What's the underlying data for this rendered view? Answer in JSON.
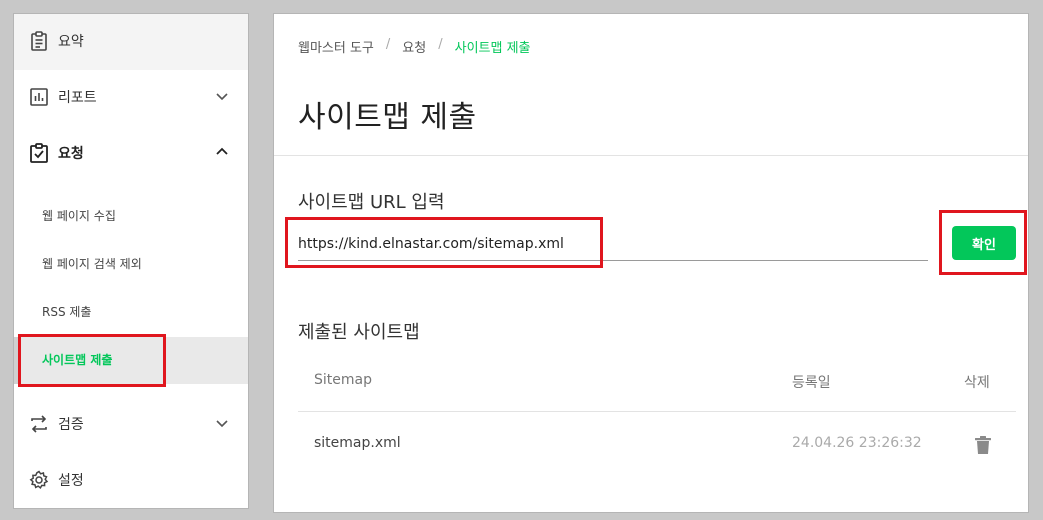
{
  "sidebar": {
    "items": [
      {
        "label": "요약",
        "icon": "clipboard-icon"
      },
      {
        "label": "리포트",
        "icon": "bar-chart-icon"
      },
      {
        "label": "요청",
        "icon": "clipboard-check-icon"
      },
      {
        "label": "검증",
        "icon": "swap-arrows-icon"
      },
      {
        "label": "설정",
        "icon": "gear-icon"
      }
    ],
    "sub_items": [
      {
        "label": "웹 페이지 수집"
      },
      {
        "label": "웹 페이지 검색 제외"
      },
      {
        "label": "RSS 제출"
      },
      {
        "label": "사이트맵 제출"
      }
    ]
  },
  "breadcrumb": {
    "items": [
      "웹마스터 도구",
      "요청",
      "사이트맵 제출"
    ],
    "separator": "/"
  },
  "page_title": "사이트맵 제출",
  "url_section": {
    "label": "사이트맵 URL 입력",
    "input_value": "https://kind.elnastar.com/sitemap.xml",
    "confirm_label": "확인"
  },
  "submitted_section": {
    "label": "제출된 사이트맵",
    "columns": [
      "Sitemap",
      "등록일",
      "삭제"
    ],
    "rows": [
      {
        "sitemap": "sitemap.xml",
        "date": "24.04.26 23:26:32",
        "delete_icon": "trash-icon"
      }
    ]
  },
  "colors": {
    "accent": "#03c75a",
    "highlight": "#e0161e"
  }
}
